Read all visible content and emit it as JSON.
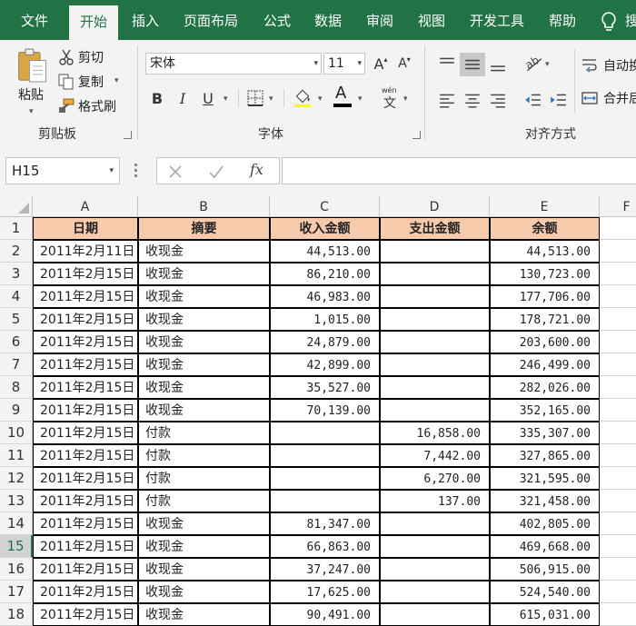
{
  "ribbon_tabs": [
    "文件",
    "开始",
    "插入",
    "页面布局",
    "公式",
    "数据",
    "审阅",
    "视图",
    "开发工具",
    "帮助",
    "搜"
  ],
  "active_tab": "开始",
  "clipboard": {
    "paste": "粘贴",
    "cut": "剪切",
    "copy": "复制",
    "format_painter": "格式刷",
    "group_label": "剪贴板"
  },
  "font": {
    "name": "宋体",
    "size": "11",
    "group_label": "字体",
    "increase_glyph": "A",
    "decrease_glyph": "A",
    "bold": "B",
    "italic": "I",
    "underline": "U",
    "font_color_glyph": "A",
    "phonetic_top": "wén",
    "phonetic_bottom": "文"
  },
  "alignment": {
    "wrap_text": "自动换",
    "merge_center": "合并后",
    "group_label": "对齐方式"
  },
  "formula_bar": {
    "name_box": "H15",
    "fx": "fx",
    "formula": ""
  },
  "sheet": {
    "columns": [
      "A",
      "B",
      "C",
      "D",
      "E",
      "F"
    ],
    "selected_row": "15",
    "header_row": {
      "row": "1",
      "cells": [
        "日期",
        "摘要",
        "收入金额",
        "支出金额",
        "余额"
      ]
    },
    "rows": [
      {
        "row": "2",
        "date": "2011年2月11日",
        "desc": "收现金",
        "income": "44,513.00",
        "expense": "",
        "balance": "44,513.00"
      },
      {
        "row": "3",
        "date": "2011年2月15日",
        "desc": "收现金",
        "income": "86,210.00",
        "expense": "",
        "balance": "130,723.00"
      },
      {
        "row": "4",
        "date": "2011年2月15日",
        "desc": "收现金",
        "income": "46,983.00",
        "expense": "",
        "balance": "177,706.00"
      },
      {
        "row": "5",
        "date": "2011年2月15日",
        "desc": "收现金",
        "income": "1,015.00",
        "expense": "",
        "balance": "178,721.00"
      },
      {
        "row": "6",
        "date": "2011年2月15日",
        "desc": "收现金",
        "income": "24,879.00",
        "expense": "",
        "balance": "203,600.00"
      },
      {
        "row": "7",
        "date": "2011年2月15日",
        "desc": "收现金",
        "income": "42,899.00",
        "expense": "",
        "balance": "246,499.00"
      },
      {
        "row": "8",
        "date": "2011年2月15日",
        "desc": "收现金",
        "income": "35,527.00",
        "expense": "",
        "balance": "282,026.00"
      },
      {
        "row": "9",
        "date": "2011年2月15日",
        "desc": "收现金",
        "income": "70,139.00",
        "expense": "",
        "balance": "352,165.00"
      },
      {
        "row": "10",
        "date": "2011年2月15日",
        "desc": "付款",
        "income": "",
        "expense": "16,858.00",
        "balance": "335,307.00"
      },
      {
        "row": "11",
        "date": "2011年2月15日",
        "desc": "付款",
        "income": "",
        "expense": "7,442.00",
        "balance": "327,865.00"
      },
      {
        "row": "12",
        "date": "2011年2月15日",
        "desc": "付款",
        "income": "",
        "expense": "6,270.00",
        "balance": "321,595.00"
      },
      {
        "row": "13",
        "date": "2011年2月15日",
        "desc": "付款",
        "income": "",
        "expense": "137.00",
        "balance": "321,458.00"
      },
      {
        "row": "14",
        "date": "2011年2月15日",
        "desc": "收现金",
        "income": "81,347.00",
        "expense": "",
        "balance": "402,805.00"
      },
      {
        "row": "15",
        "date": "2011年2月15日",
        "desc": "收现金",
        "income": "66,863.00",
        "expense": "",
        "balance": "469,668.00"
      },
      {
        "row": "16",
        "date": "2011年2月15日",
        "desc": "收现金",
        "income": "37,247.00",
        "expense": "",
        "balance": "506,915.00"
      },
      {
        "row": "17",
        "date": "2011年2月15日",
        "desc": "收现金",
        "income": "17,625.00",
        "expense": "",
        "balance": "524,540.00"
      },
      {
        "row": "18",
        "date": "2011年2月15日",
        "desc": "收现金",
        "income": "90,491.00",
        "expense": "",
        "balance": "615,031.00"
      }
    ]
  },
  "colors": {
    "ribbon_green": "#217346",
    "header_fill": "#f8cbad",
    "font_color_bar": "#000000",
    "fill_color_bar": "#ffff00"
  },
  "icons": [
    "paste-icon",
    "cut-icon",
    "copy-icon",
    "format-painter-icon",
    "lightbulb-icon",
    "borders-icon",
    "fill-color-icon",
    "font-color-icon",
    "orientation-icon",
    "wrap-text-icon",
    "merge-icon",
    "cancel-icon",
    "enter-icon"
  ]
}
